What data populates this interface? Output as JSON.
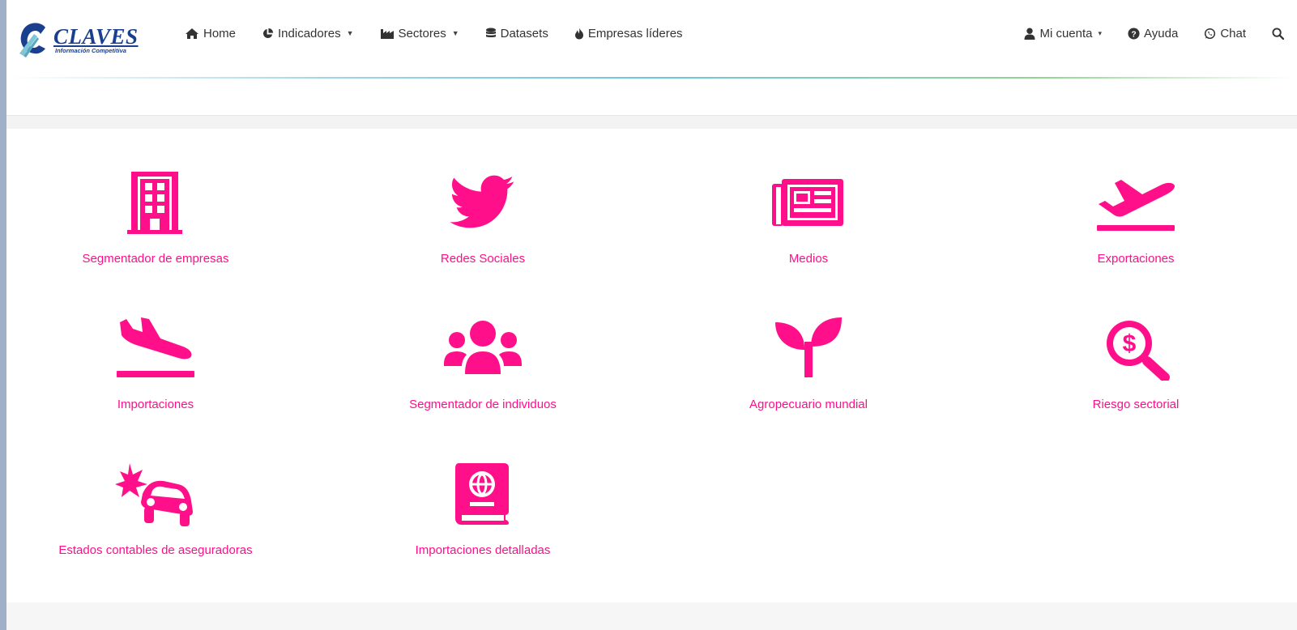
{
  "brand": {
    "name": "CLAVES",
    "tagline": "Información Competitiva"
  },
  "nav": {
    "left": [
      {
        "label": "Home",
        "icon": "home-icon",
        "caret": false
      },
      {
        "label": "Indicadores",
        "icon": "pie-chart-icon",
        "caret": true
      },
      {
        "label": "Sectores",
        "icon": "industry-icon",
        "caret": true
      },
      {
        "label": "Datasets",
        "icon": "database-icon",
        "caret": false
      },
      {
        "label": "Empresas líderes",
        "icon": "fire-icon",
        "caret": false
      }
    ],
    "right": [
      {
        "label": "Mi cuenta",
        "icon": "user-icon",
        "caret": true
      },
      {
        "label": "Ayuda",
        "icon": "help-icon",
        "caret": false
      },
      {
        "label": "Chat",
        "icon": "whatsapp-icon",
        "caret": false
      },
      {
        "label": "",
        "icon": "search-icon",
        "caret": false
      }
    ]
  },
  "tiles": [
    {
      "label": "Segmentador de empresas",
      "icon": "building-icon"
    },
    {
      "label": "Redes Sociales",
      "icon": "twitter-icon"
    },
    {
      "label": "Medios",
      "icon": "newspaper-icon"
    },
    {
      "label": "Exportaciones",
      "icon": "plane-departure-icon"
    },
    {
      "label": "Importaciones",
      "icon": "plane-arrival-icon"
    },
    {
      "label": "Segmentador de individuos",
      "icon": "users-icon"
    },
    {
      "label": "Agropecuario mundial",
      "icon": "seedling-icon"
    },
    {
      "label": "Riesgo sectorial",
      "icon": "search-dollar-icon"
    },
    {
      "label": "Estados contables de aseguradoras",
      "icon": "car-crash-icon"
    },
    {
      "label": "Importaciones detalladas",
      "icon": "passport-icon"
    }
  ],
  "colors": {
    "accent": "#ff0f8a",
    "brand": "#1b3f8f",
    "nav_text": "#333333"
  }
}
